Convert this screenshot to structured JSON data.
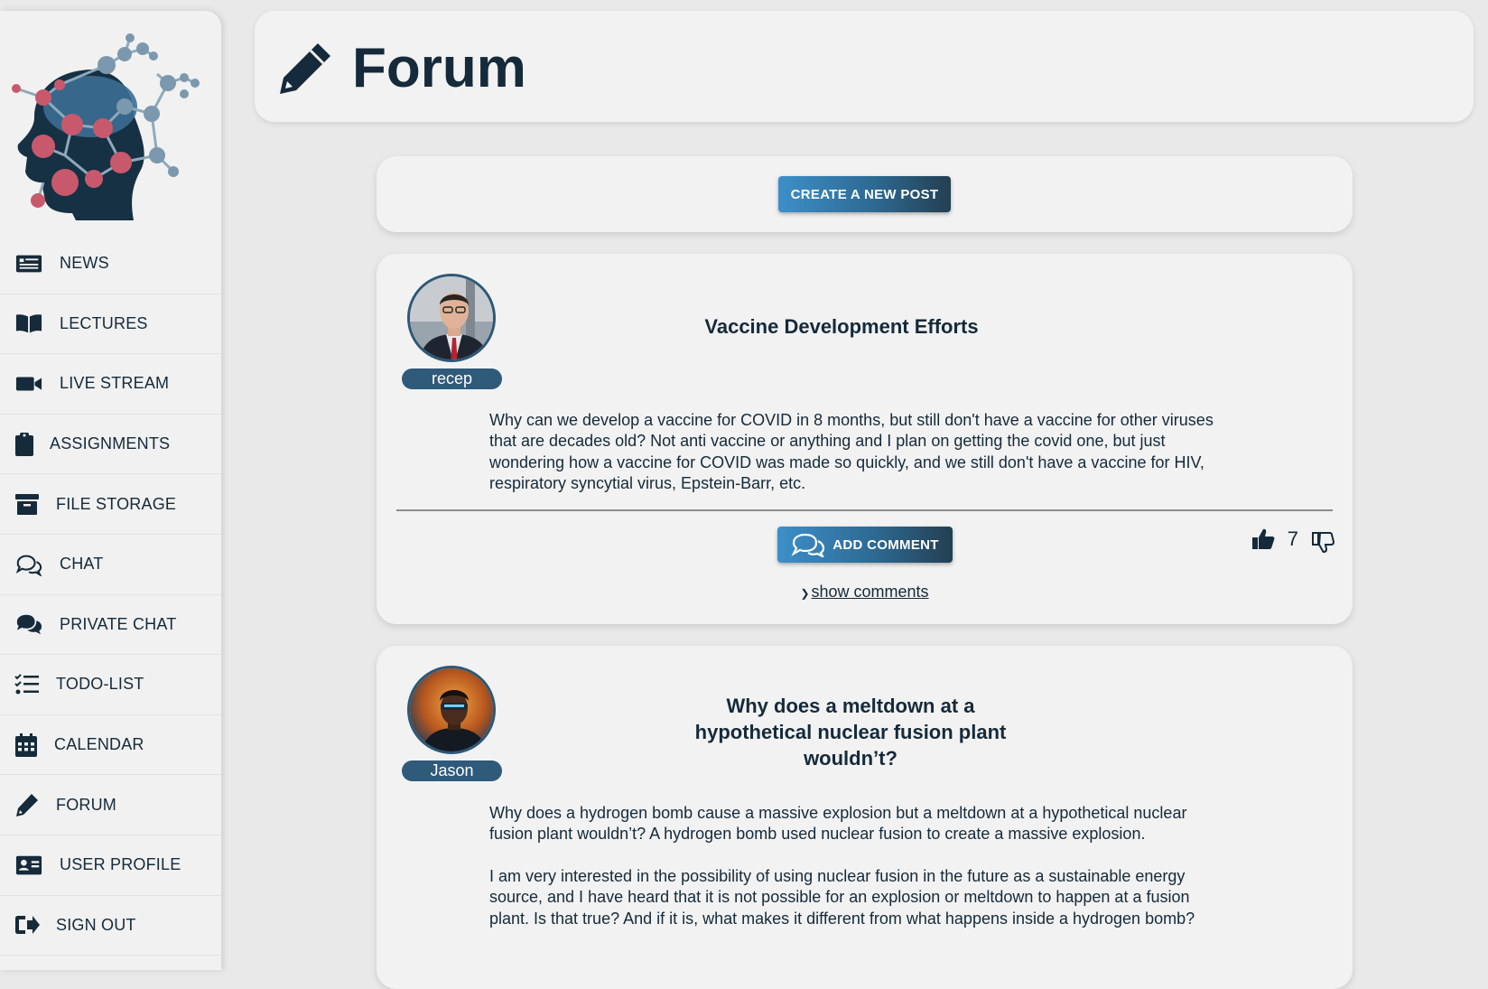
{
  "sidebar": {
    "items": [
      {
        "label": "NEWS",
        "icon": "newspaper-icon"
      },
      {
        "label": "LECTURES",
        "icon": "book-open-icon"
      },
      {
        "label": "LIVE STREAM",
        "icon": "video-camera-icon"
      },
      {
        "label": "ASSIGNMENTS",
        "icon": "clipboard-icon"
      },
      {
        "label": "FILE STORAGE",
        "icon": "archive-icon"
      },
      {
        "label": "CHAT",
        "icon": "comments-icon"
      },
      {
        "label": "PRIVATE CHAT",
        "icon": "comments-solid-icon"
      },
      {
        "label": "TODO-LIST",
        "icon": "checklist-icon"
      },
      {
        "label": "CALENDAR",
        "icon": "calendar-icon"
      },
      {
        "label": "FORUM",
        "icon": "pencil-icon"
      },
      {
        "label": "USER PROFILE",
        "icon": "id-card-icon"
      },
      {
        "label": "SIGN OUT",
        "icon": "sign-out-icon"
      }
    ]
  },
  "header": {
    "title": "Forum",
    "icon": "pencil-icon"
  },
  "create_post": {
    "label": "CREATE A NEW POST"
  },
  "posts": [
    {
      "author": "recep",
      "title": "Vaccine Development Efforts",
      "body": [
        "Why can we develop a vaccine for COVID in 8 months, but still don't have a vaccine for other viruses that are decades old? Not anti vaccine or anything and I plan on getting the covid one, but just wondering how a vaccine for COVID was made so quickly, and we still don't have a vaccine for HIV, respiratory syncytial virus, Epstein-Barr, etc."
      ],
      "add_comment_label": "ADD COMMENT",
      "votes": "7",
      "show_comments_label": "show comments"
    },
    {
      "author": "Jason",
      "title": "Why does a meltdown at a hypothetical nuclear fusion plant wouldn’t?",
      "body": [
        "Why does a hydrogen bomb cause a massive explosion but a meltdown at a hypothetical nuclear fusion plant wouldn’t? A hydrogen bomb used nuclear fusion to create a massive explosion.",
        "I am very interested in the possibility of using nuclear fusion in the future as a sustainable energy source, and I have heard that it is not possible for an explosion or meltdown to happen at a fusion plant. Is that true? And if it is, what makes it different from what happens inside a hydrogen bomb?"
      ]
    }
  ],
  "colors": {
    "primary": "#152a3a",
    "accent": "#3d8fc9",
    "badge": "#2f5a7a"
  }
}
